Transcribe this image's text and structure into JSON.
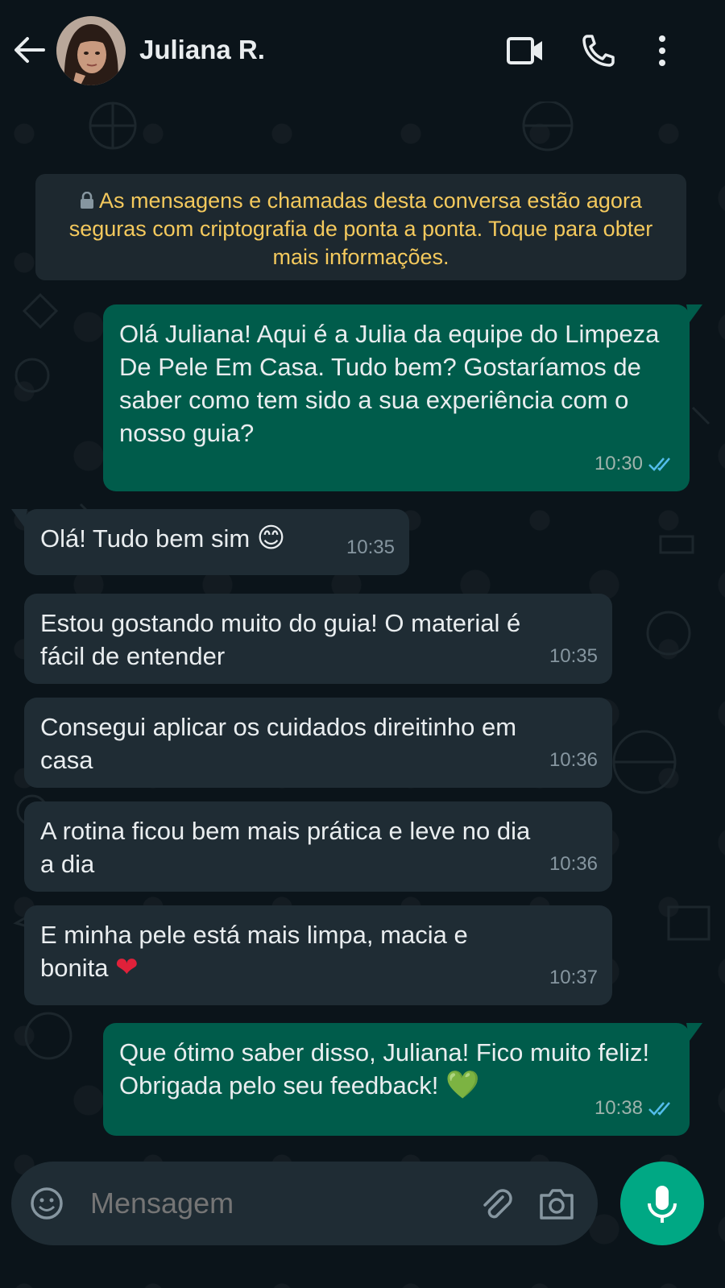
{
  "header": {
    "contact_name": "Juliana R.",
    "icons": [
      "back-arrow-icon",
      "video-call-icon",
      "phone-icon",
      "more-vertical-icon"
    ]
  },
  "notice": {
    "text": "As mensagens e chamadas desta conversa estão agora seguras com criptografia de ponta a ponta. Toque para obter mais informações."
  },
  "messages": [
    {
      "direction": "out",
      "text": "Olá Juliana! Aqui é a Julia da equipe do Limpeza De Pele Em Casa. Tudo bem? Gostaríamos de saber como tem sido a sua experiência com o nosso guia?",
      "time": "10:30",
      "status": "read"
    },
    {
      "direction": "in",
      "text": "Olá! Tudo bem sim",
      "emoji": "😊",
      "time": "10:35"
    },
    {
      "direction": "in",
      "text": "Estou gostando muito do guia! O material é fácil de entender",
      "time": "10:35"
    },
    {
      "direction": "in",
      "text": "Consegui aplicar os cuidados direitinho em casa",
      "time": "10:36"
    },
    {
      "direction": "in",
      "text": "A rotina ficou bem mais prática e leve no dia a dia",
      "time": "10:36"
    },
    {
      "direction": "in",
      "text": "E minha pele está mais limpa, macia e bonita",
      "emoji": "❤",
      "time": "10:37"
    },
    {
      "direction": "out",
      "text": "Que ótimo saber disso, Juliana! Fico muito feliz! Obrigada pelo seu feedback!",
      "emoji": "💚",
      "time": "10:38",
      "status": "read"
    }
  ],
  "composer": {
    "placeholder": "Mensagem",
    "icons": [
      "emoji-icon",
      "attach-icon",
      "camera-icon",
      "mic-icon"
    ]
  },
  "colors": {
    "background": "#0b141a",
    "outgoing_bubble": "#005c4b",
    "incoming_bubble": "#1f2c34",
    "notice_text": "#f4c95d",
    "read_tick": "#53bdeb",
    "accent": "#00a884"
  }
}
